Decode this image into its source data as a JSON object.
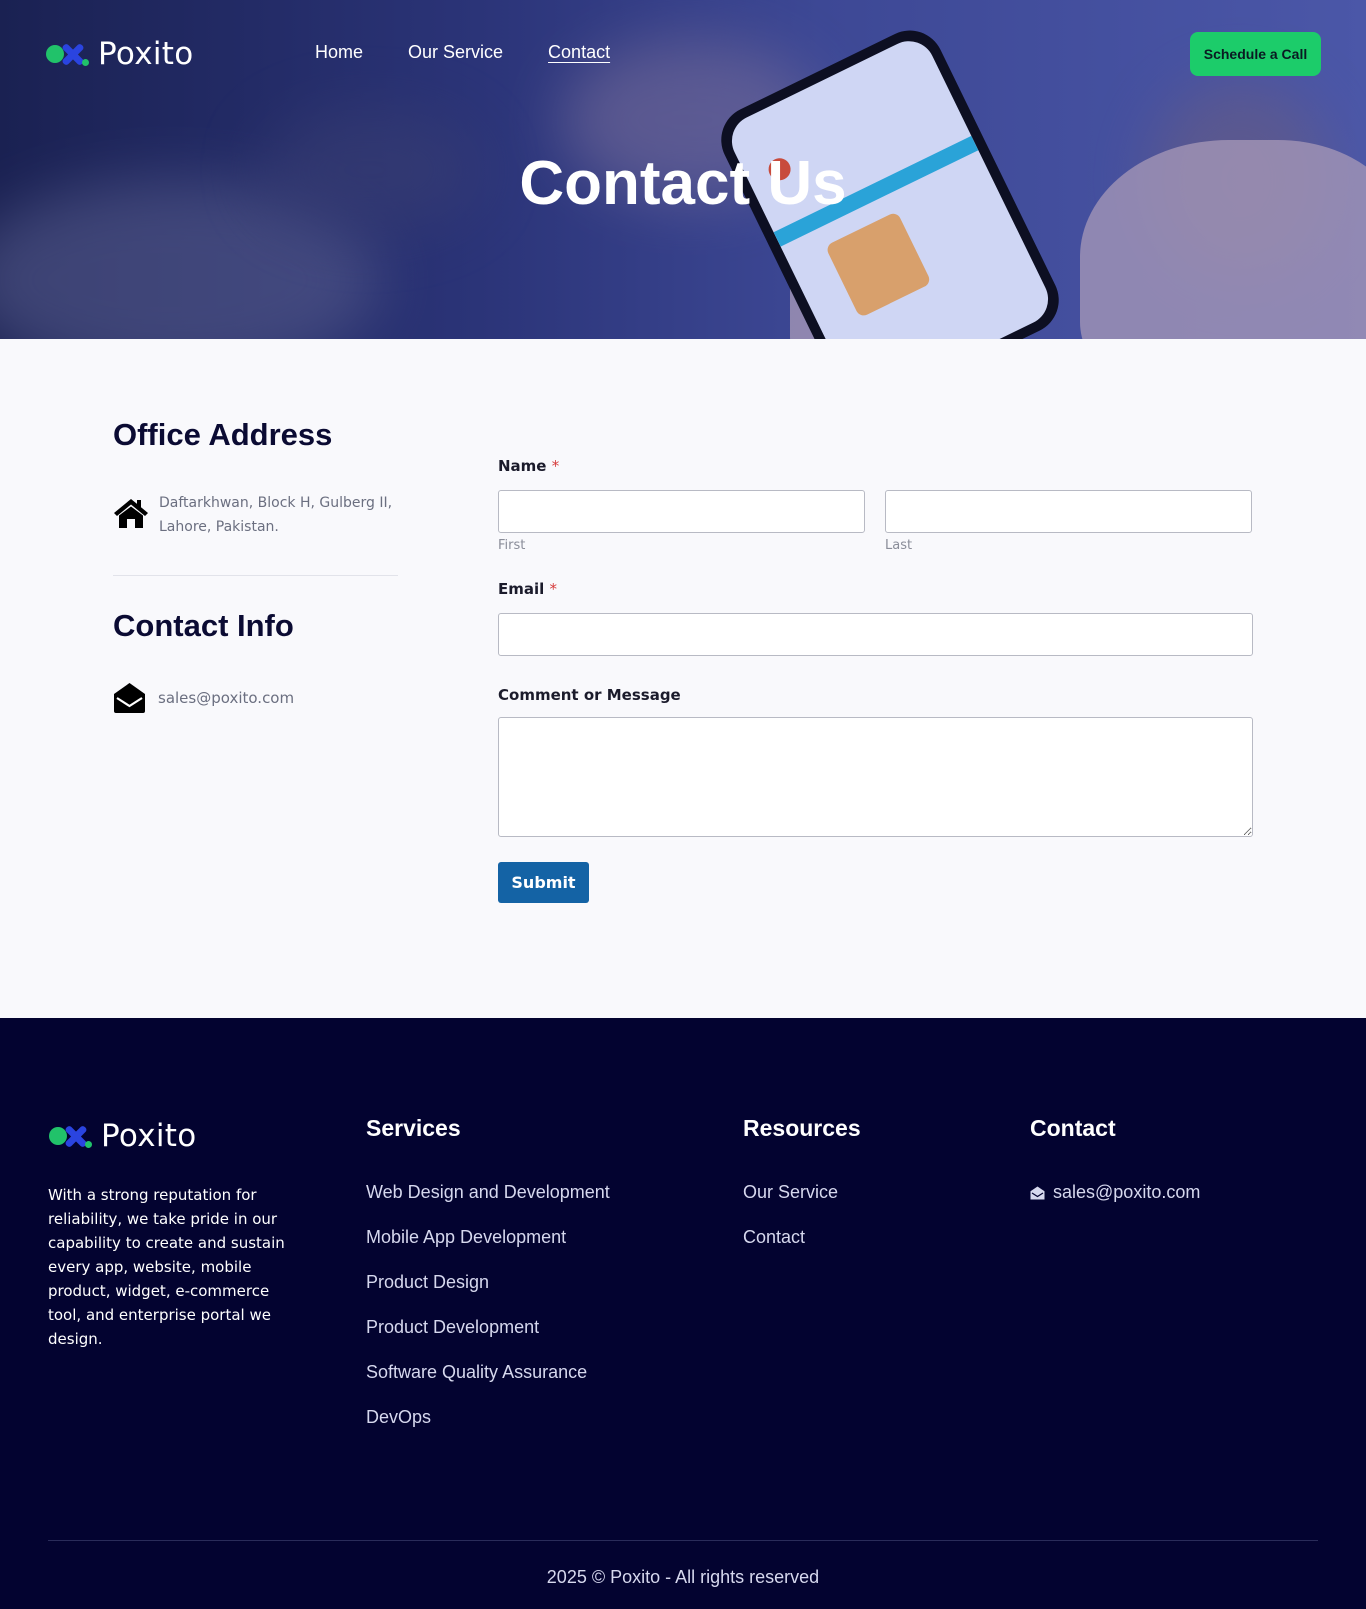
{
  "brand": {
    "name": "Poxito",
    "green": "#21c26a",
    "blue": "#2a44e0"
  },
  "nav": {
    "links": [
      {
        "label": "Home"
      },
      {
        "label": "Our Service"
      },
      {
        "label": "Contact",
        "active": true
      }
    ],
    "cta_label": "Schedule a Call",
    "cta_color": "#1ccc6a"
  },
  "hero": {
    "title": "Contact Us"
  },
  "office": {
    "heading": "Office Address",
    "address_line1": "Daftarkhwan, Block H, Gulberg II,",
    "address_line2": "Lahore, Pakistan.",
    "icon": "home-icon"
  },
  "contact_info": {
    "heading": "Contact Info",
    "email": "sales@poxito.com",
    "icon": "envelope-open-icon"
  },
  "form": {
    "name_label": "Name",
    "required_mark": "*",
    "first_sub": "First",
    "last_sub": "Last",
    "first_value": "",
    "last_value": "",
    "email_label": "Email",
    "email_value": "",
    "message_label": "Comment or Message",
    "message_value": "",
    "submit_label": "Submit",
    "submit_color": "#1463a5"
  },
  "footer": {
    "about": "With a strong reputation for reliability, we take pride in our capability to create and sustain every app, website, mobile product, widget, e-commerce tool, and enterprise portal we design.",
    "services_heading": "Services",
    "services": [
      "Web Design and Development",
      "Mobile App Development",
      "Product Design",
      "Product Development",
      "Software Quality Assurance",
      "DevOps"
    ],
    "resources_heading": "Resources",
    "resources": [
      "Our Service",
      "Contact"
    ],
    "contact_heading": "Contact",
    "contact_email": "sales@poxito.com",
    "copyright": "2025 © Poxito - All rights reserved",
    "background": "#030330"
  }
}
